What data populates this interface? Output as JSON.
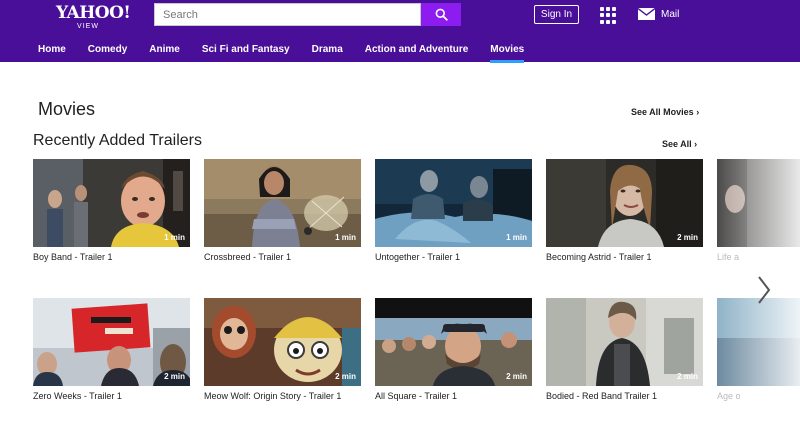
{
  "brand": {
    "logo_main": "YAHOO!",
    "logo_sub": "VIEW"
  },
  "search": {
    "placeholder": "Search"
  },
  "header": {
    "signin_label": "Sign In",
    "mail_label": "Mail"
  },
  "nav": [
    {
      "label": "Home",
      "active": false
    },
    {
      "label": "Comedy",
      "active": false
    },
    {
      "label": "Anime",
      "active": false
    },
    {
      "label": "Sci Fi and Fantasy",
      "active": false
    },
    {
      "label": "Drama",
      "active": false
    },
    {
      "label": "Action and Adventure",
      "active": false
    },
    {
      "label": "Movies",
      "active": true
    }
  ],
  "page": {
    "title": "Movies",
    "see_all_movies": "See All Movies ›"
  },
  "section": {
    "title": "Recently Added Trailers",
    "see_all": "See All ›"
  },
  "trailers_row1": [
    {
      "title": "Boy Band - Trailer 1",
      "duration": "1 min"
    },
    {
      "title": "Crossbreed - Trailer 1",
      "duration": "1 min"
    },
    {
      "title": "Untogether - Trailer 1",
      "duration": "1 min"
    },
    {
      "title": "Becoming Astrid - Trailer 1",
      "duration": "2 min"
    },
    {
      "title": "Life a",
      "duration": ""
    }
  ],
  "trailers_row2": [
    {
      "title": "Zero Weeks - Trailer 1",
      "duration": "2 min"
    },
    {
      "title": "Meow Wolf: Origin Story - Trailer 1",
      "duration": "2 min"
    },
    {
      "title": "All Square - Trailer 1",
      "duration": "2 min"
    },
    {
      "title": "Bodied - Red Band Trailer 1",
      "duration": "2 min"
    },
    {
      "title": "Age o",
      "duration": ""
    }
  ],
  "colors": {
    "header_bg": "#4a0f99",
    "search_button": "#8c1cf0",
    "nav_active_underline": "#2e9fff"
  },
  "icons": {
    "search": "search-icon",
    "apps": "apps-grid-icon",
    "mail": "mail-icon",
    "next": "chevron-right-icon"
  }
}
